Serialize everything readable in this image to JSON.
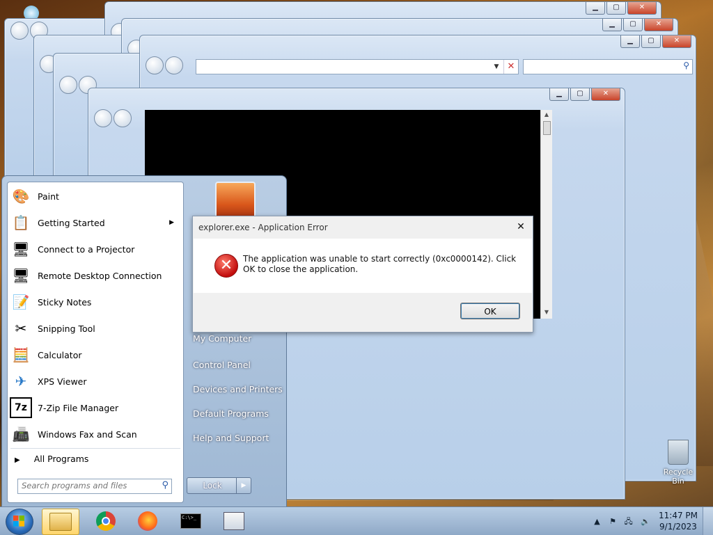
{
  "dialog": {
    "title": "explorer.exe - Application Error",
    "close_glyph": "✕",
    "message": "The application was unable to start correctly (0xc0000142). Click OK to close the application.",
    "ok_label": "OK",
    "error_glyph": "✕"
  },
  "start_menu": {
    "programs": [
      {
        "label": "Paint",
        "icon": "paint-icon",
        "glyph": "🎨"
      },
      {
        "label": "Getting Started",
        "icon": "getting-started-icon",
        "glyph": "📋",
        "has_submenu": true
      },
      {
        "label": "Connect to a Projector",
        "icon": "projector-icon",
        "glyph": "🖥"
      },
      {
        "label": "Remote Desktop Connection",
        "icon": "remote-desktop-icon",
        "glyph": "🖥"
      },
      {
        "label": "Sticky Notes",
        "icon": "sticky-notes-icon",
        "glyph": "📝"
      },
      {
        "label": "Snipping Tool",
        "icon": "snipping-tool-icon",
        "glyph": "✂"
      },
      {
        "label": "Calculator",
        "icon": "calculator-icon",
        "glyph": "🧮"
      },
      {
        "label": "XPS Viewer",
        "icon": "xps-viewer-icon",
        "glyph": "✈"
      },
      {
        "label": "7-Zip File Manager",
        "icon": "seven-zip-icon",
        "glyph": "7z"
      },
      {
        "label": "Windows Fax and Scan",
        "icon": "fax-scan-icon",
        "glyph": "📠"
      }
    ],
    "all_programs": "All Programs",
    "search_placeholder": "Search programs and files",
    "right_links": [
      "My Computer",
      "Control Panel",
      "Devices and Printers",
      "Default Programs",
      "Help and Support"
    ],
    "lock_label": "Lock"
  },
  "desktop": {
    "recycle_bin_label": "Recycle Bin"
  },
  "taskbar": {
    "time": "11:47 PM",
    "date": "9/1/2023",
    "tray_chevron": "▲",
    "cmd_text": "C:\\>_"
  },
  "colors": {
    "taskbar": "#8fa9c7",
    "error_red": "#c20d0d",
    "dialog_bg": "#f0f0f0"
  }
}
